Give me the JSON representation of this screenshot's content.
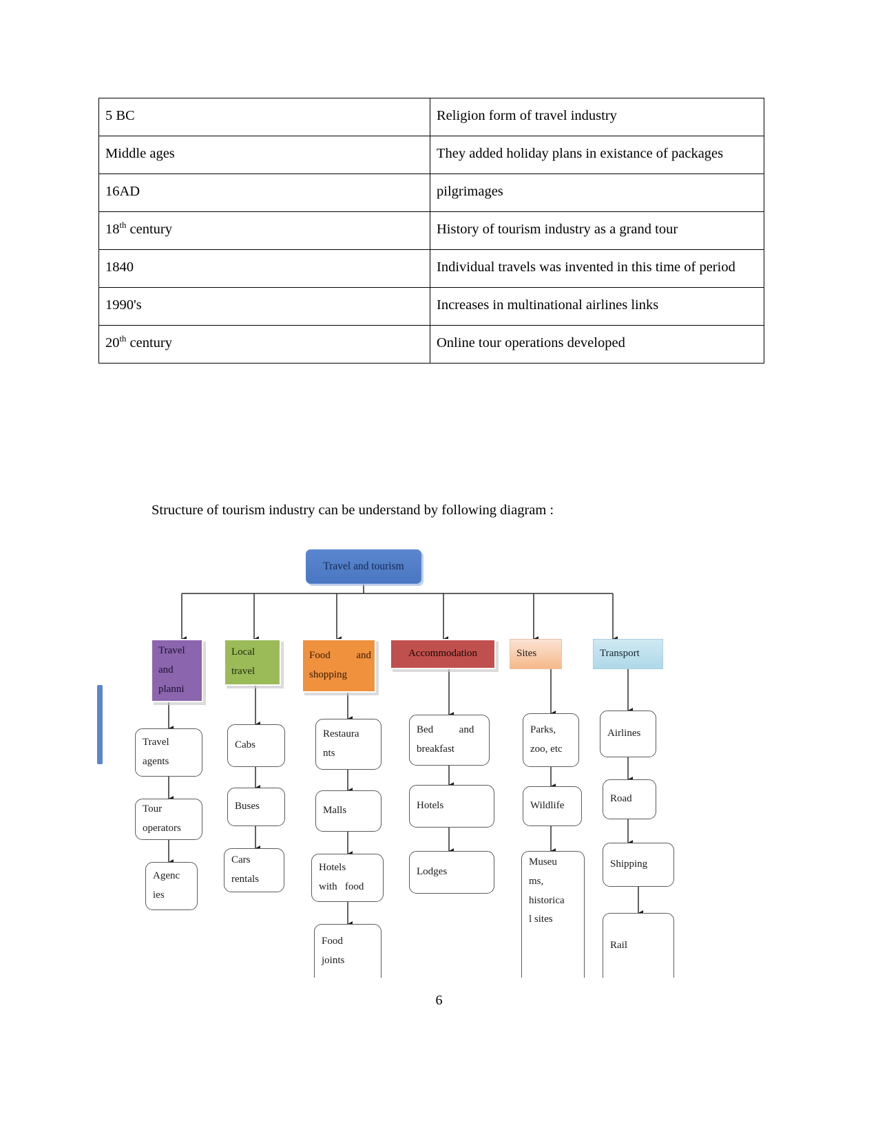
{
  "document": {
    "page_number": "6",
    "caption": "Structure of tourism industry can be understand by following diagram :"
  },
  "history_table": {
    "rows": [
      {
        "period": "5 BC",
        "period_sup": "",
        "event": "Religion form of travel industry"
      },
      {
        "period": "Middle ages",
        "period_sup": "",
        "event": "They added holiday plans in existance of packages"
      },
      {
        "period": "16AD",
        "period_sup": "",
        "event": "pilgrimages"
      },
      {
        "period": "18",
        "period_sup": "th",
        "period_tail": " century",
        "event": "History of tourism industry as a grand tour"
      },
      {
        "period": "1840",
        "period_sup": "",
        "event": "Individual travels was invented in this time of period"
      },
      {
        "period": "1990's",
        "period_sup": "",
        "event": "Increases in multinational airlines links"
      },
      {
        "period": "20",
        "period_sup": "th",
        "period_tail": " century",
        "event": "Online tour operations developed"
      }
    ]
  },
  "diagram": {
    "root": {
      "label": "Travel and tourism",
      "color": "#4a77c2"
    },
    "branches": [
      {
        "label_lines": [
          "Travel",
          "and",
          "planni"
        ],
        "color": "#8b65ad",
        "children": [
          {
            "lines": [
              "Travel",
              "agents"
            ]
          },
          {
            "lines": [
              "Tour",
              "operators"
            ]
          },
          {
            "lines": [
              "Agenc",
              "ies"
            ]
          }
        ]
      },
      {
        "label_lines": [
          "Local",
          "travel"
        ],
        "color": "#9bbb59",
        "children": [
          {
            "lines": [
              "Cabs"
            ]
          },
          {
            "lines": [
              "Buses"
            ]
          },
          {
            "lines": [
              "Cars",
              "rentals"
            ]
          }
        ]
      },
      {
        "label_lines": [
          "Food          and",
          "shopping"
        ],
        "color": "#f0913e",
        "children": [
          {
            "lines": [
              "Restaura",
              "nts"
            ]
          },
          {
            "lines": [
              "Malls"
            ]
          },
          {
            "lines": [
              "Hotels",
              "with   food"
            ]
          },
          {
            "lines": [
              "Food",
              "joints"
            ]
          }
        ]
      },
      {
        "label_lines": [
          "Accommodation"
        ],
        "color": "#c0504d",
        "children": [
          {
            "lines": [
              "Bed          and",
              "breakfast"
            ]
          },
          {
            "lines": [
              "Hotels"
            ]
          },
          {
            "lines": [
              "Lodges"
            ]
          }
        ]
      },
      {
        "label_lines": [
          "Sites"
        ],
        "color": "#f6b98b",
        "children": [
          {
            "lines": [
              "Parks,",
              "zoo, etc"
            ]
          },
          {
            "lines": [
              "Wildlife"
            ]
          },
          {
            "lines": [
              "Museu",
              "ms,",
              "historica",
              "l sites"
            ]
          }
        ]
      },
      {
        "label_lines": [
          "Transport"
        ],
        "color": "#aed9e8",
        "children": [
          {
            "lines": [
              "Airlines"
            ]
          },
          {
            "lines": [
              "Road"
            ]
          },
          {
            "lines": [
              "Shipping"
            ]
          },
          {
            "lines": [
              "Rail"
            ]
          }
        ]
      }
    ]
  }
}
